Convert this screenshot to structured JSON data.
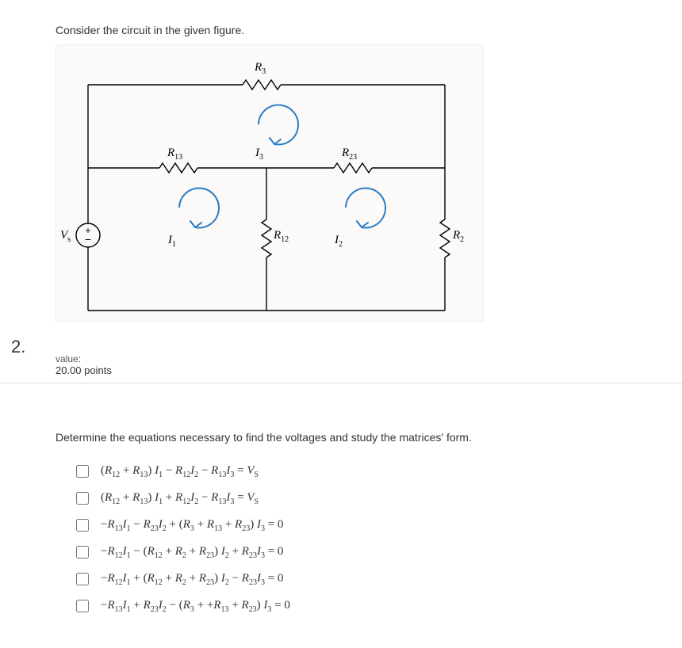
{
  "intro": "Consider the circuit in the given figure.",
  "circuit": {
    "Vs": "V",
    "Vs_sub": "s",
    "R3": "R",
    "R3_sub": "3",
    "R13": "R",
    "R13_sub": "13",
    "R23": "R",
    "R23_sub": "23",
    "R12": "R",
    "R12_sub": "12",
    "R2": "R",
    "R2_sub": "2",
    "I1": "I",
    "I1_sub": "1",
    "I2": "I",
    "I2_sub": "2",
    "I3": "I",
    "I3_sub": "3"
  },
  "qnum": "2.",
  "meta_label": "value:",
  "points": "20.00 points",
  "prompt": "Determine the equations necessary to find the voltages and study the matrices' form.",
  "options": [
    "(R₁₂ + R₁₃) I₁ − R₁₂I₂ − R₁₃I₃ = Vₛ",
    "(R₁₂ + R₁₃) I₁ + R₁₂I₂ − R₁₃I₃ = Vₛ",
    "−R₁₃I₁ − R₂₃I₂ + (R₃ + R₁₃ + R₂₃) I₃ = 0",
    "−R₁₂I₁ − (R₁₂ + R₂ + R₂₃) I₂ + R₂₃I₃ = 0",
    "−R₁₂I₁ + (R₁₂ + R₂ + R₂₃) I₂ − R₂₃I₃ = 0",
    "−R₁₃I₁ + R₂₃I₂ − (R₃ + +R₁₃ + R₂₃) I₃ = 0"
  ]
}
